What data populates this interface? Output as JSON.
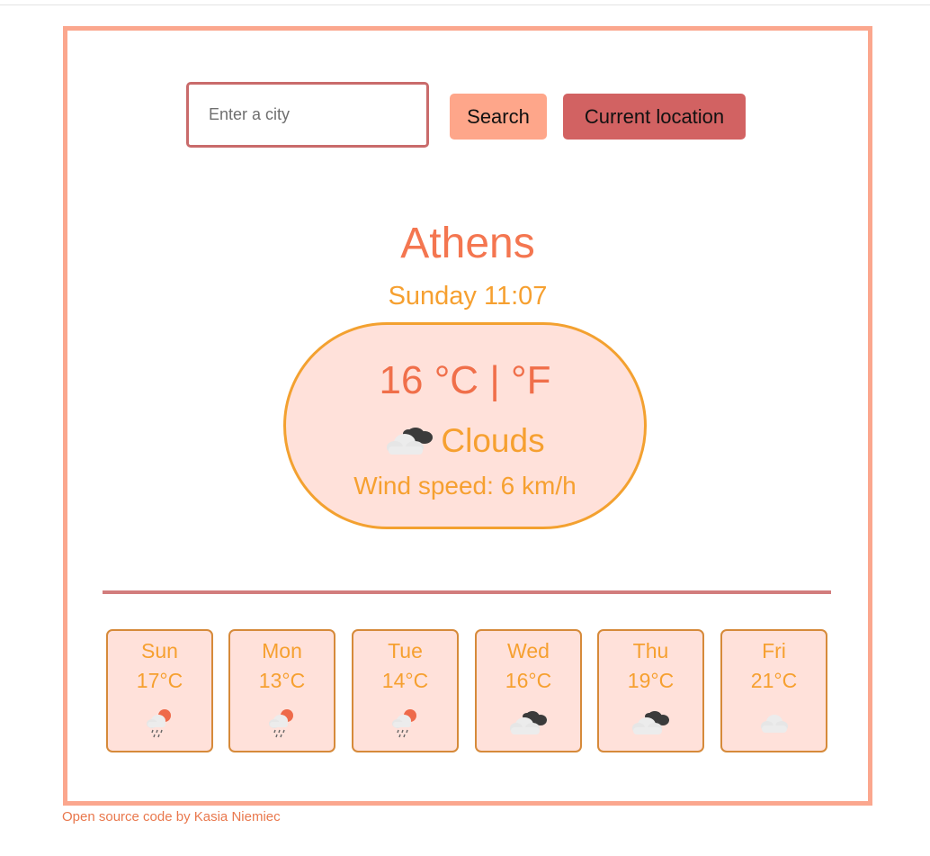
{
  "search": {
    "placeholder": "Enter a city",
    "value": "",
    "search_label": "Search",
    "location_label": "Current location"
  },
  "current": {
    "city": "Athens",
    "day_time": "Sunday 11:07",
    "temperature": "16",
    "unit_celsius": " °C",
    "unit_separator": " | ",
    "unit_fahrenheit": "°F",
    "condition_icon": "clouds-icon",
    "condition": "Clouds",
    "wind": "Wind speed: 6 km/h"
  },
  "forecast": [
    {
      "day": "Sun",
      "temp": "17°C",
      "icon": "rain-sun-icon"
    },
    {
      "day": "Mon",
      "temp": "13°C",
      "icon": "rain-sun-icon"
    },
    {
      "day": "Tue",
      "temp": "14°C",
      "icon": "rain-sun-icon"
    },
    {
      "day": "Wed",
      "temp": "16°C",
      "icon": "broken-clouds-icon"
    },
    {
      "day": "Thu",
      "temp": "19°C",
      "icon": "broken-clouds-icon"
    },
    {
      "day": "Fri",
      "temp": "21°C",
      "icon": "cloud-icon"
    }
  ],
  "footer": {
    "text": "Open source code by Kasia Niemiec"
  },
  "colors": {
    "frame_border": "#fba78e",
    "accent_orange": "#f6a030",
    "accent_coral": "#f06f4a",
    "search_button": "#fea68a",
    "location_button": "#d26262",
    "card_background": "#ffe1da"
  }
}
